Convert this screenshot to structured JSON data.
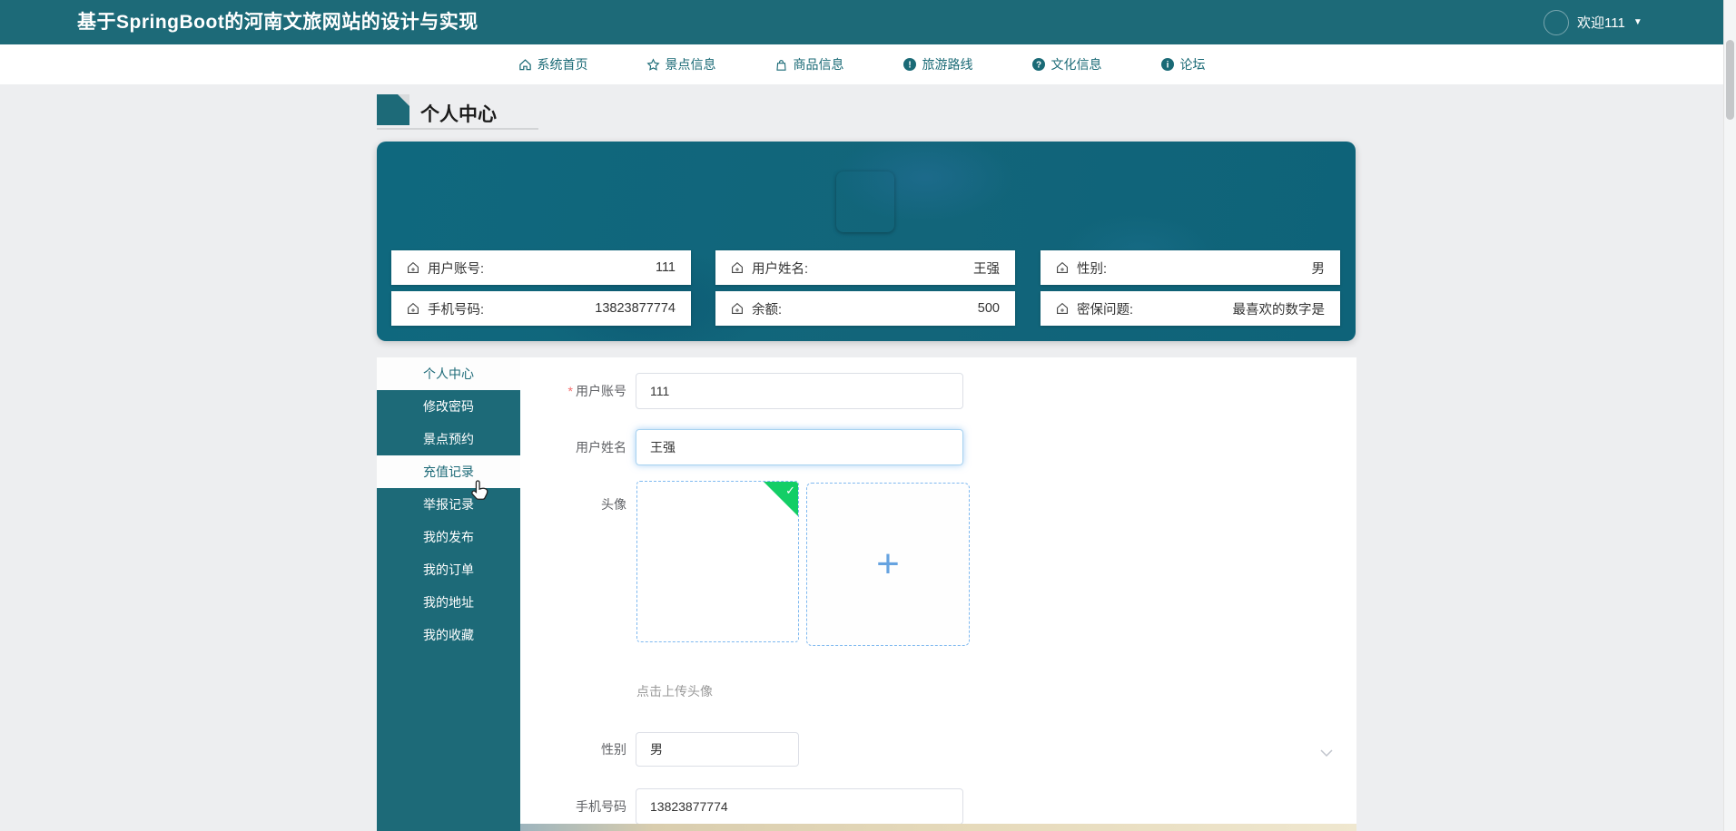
{
  "header": {
    "title": "基于SpringBoot的河南文旅网站的设计与实现",
    "welcome_text": "欢迎111",
    "caret": "▼"
  },
  "nav": {
    "items": [
      {
        "label": "系统首页",
        "icon": "home-icon"
      },
      {
        "label": "景点信息",
        "icon": "star-icon"
      },
      {
        "label": "商品信息",
        "icon": "bag-icon"
      },
      {
        "label": "旅游路线",
        "icon": "exclamation-circle-icon"
      },
      {
        "label": "文化信息",
        "icon": "question-circle-icon"
      },
      {
        "label": "论坛",
        "icon": "info-circle-icon"
      }
    ]
  },
  "page": {
    "title": "个人中心"
  },
  "profile_card": {
    "fields": [
      {
        "label": "用户账号:",
        "value": "111"
      },
      {
        "label": "用户姓名:",
        "value": "王强"
      },
      {
        "label": "性别:",
        "value": "男"
      },
      {
        "label": "手机号码:",
        "value": "13823877774"
      },
      {
        "label": "余额:",
        "value": "500"
      },
      {
        "label": "密保问题:",
        "value": "最喜欢的数字是"
      }
    ]
  },
  "sidebar": {
    "items": [
      {
        "label": "个人中心",
        "state": "active"
      },
      {
        "label": "修改密码",
        "state": "normal"
      },
      {
        "label": "景点预约",
        "state": "normal"
      },
      {
        "label": "充值记录",
        "state": "hover"
      },
      {
        "label": "举报记录",
        "state": "normal"
      },
      {
        "label": "我的发布",
        "state": "normal"
      },
      {
        "label": "我的订单",
        "state": "normal"
      },
      {
        "label": "我的地址",
        "state": "normal"
      },
      {
        "label": "我的收藏",
        "state": "normal"
      }
    ]
  },
  "form": {
    "account_label": "用户账号",
    "required_mark": "*",
    "account_value": "111",
    "name_label": "用户姓名",
    "name_value": "王强",
    "avatar_label": "头像",
    "upload_plus": "+",
    "upload_hint": "点击上传头像",
    "gender_label": "性别",
    "gender_value": "男",
    "phone_label": "手机号码",
    "phone_value": "13823877774"
  },
  "colors": {
    "header_teal": "#1d6a78",
    "card_teal": "#0f687e",
    "nav_text": "#1a6a76",
    "active_item_text": "#1d6a78",
    "upload_blue": "#66a3e0",
    "success_green": "#13ce66",
    "required_red": "#f56c6c"
  }
}
